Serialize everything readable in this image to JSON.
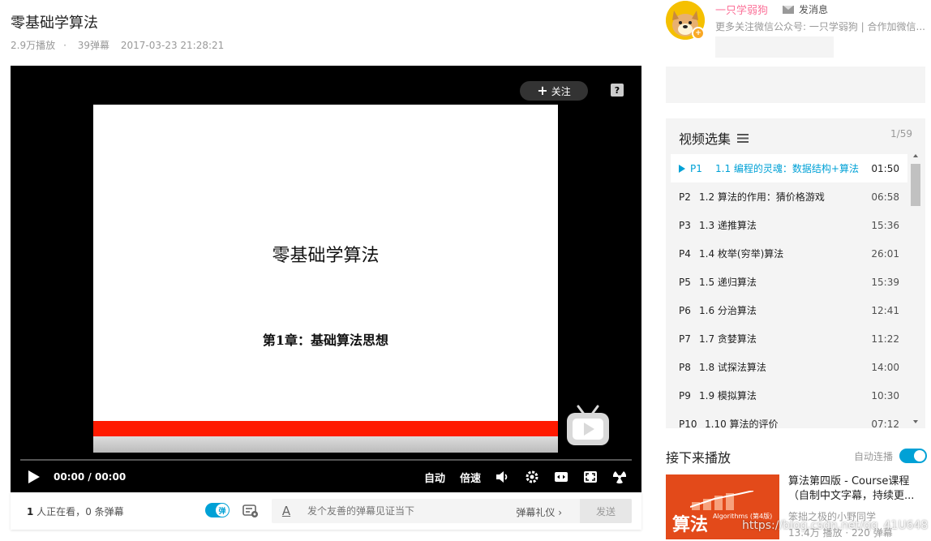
{
  "video": {
    "title": "零基础学算法",
    "views": "2.9万播放",
    "separator": "·",
    "danmaku_count": "39弹幕",
    "date": "2017-03-23 21:28:21"
  },
  "player": {
    "follow_label": "关注",
    "slide_title": "零基础学算法",
    "slide_subtitle": "第1章：基础算法思想",
    "current_time": "00:00",
    "time_separator": "/",
    "duration": "00:00",
    "auto_label": "自动",
    "speed_label": "倍速"
  },
  "bottom_bar": {
    "watching_count": "1",
    "watching_text": " 人正在看，",
    "danmaku_total": "0",
    "danmaku_text": " 条弹幕",
    "toggle_label": "弹",
    "input_placeholder": "发个友善的弹幕见证当下",
    "etiquette_label": "弹幕礼仪 ›",
    "send_label": "发送"
  },
  "uploader": {
    "name": "一只学弱狗",
    "message_label": "发消息",
    "description": "更多关注微信公众号: 一只学弱狗 | 合作加微信..."
  },
  "playlist": {
    "header": "视频选集",
    "count": "1/59",
    "items": [
      {
        "p": "P1",
        "title": "1.1 编程的灵魂：数据结构+算法",
        "duration": "01:50"
      },
      {
        "p": "P2",
        "title": "1.2 算法的作用：猜价格游戏",
        "duration": "06:58"
      },
      {
        "p": "P3",
        "title": "1.3 递推算法",
        "duration": "15:36"
      },
      {
        "p": "P4",
        "title": "1.4 枚举(穷举)算法",
        "duration": "26:01"
      },
      {
        "p": "P5",
        "title": "1.5 递归算法",
        "duration": "15:39"
      },
      {
        "p": "P6",
        "title": "1.6 分治算法",
        "duration": "12:41"
      },
      {
        "p": "P7",
        "title": "1.7 贪婪算法",
        "duration": "11:22"
      },
      {
        "p": "P8",
        "title": "1.8 试探法算法",
        "duration": "14:00"
      },
      {
        "p": "P9",
        "title": "1.9 模拟算法",
        "duration": "10:30"
      },
      {
        "p": "P10",
        "title": "1.10 算法的评价",
        "duration": "07:12"
      }
    ]
  },
  "next_up": {
    "header": "接下来播放",
    "autoplay_label": "自动连播",
    "rec_thumb_title": "算法",
    "rec_thumb_sub": "Algorithms (第4版)",
    "rec_title": "算法第四版 - Course课程（自制中文字幕，持续更...",
    "rec_author": "笨拙之极的小野同学",
    "rec_stats": "13.4万 播放 · 220 弹幕",
    "watermark": "https://blog.csdn.net/qq_41U648"
  },
  "colors": {
    "accent": "#00a1d6",
    "pink": "#fb7299",
    "slide_bar": "#ff1a00"
  }
}
